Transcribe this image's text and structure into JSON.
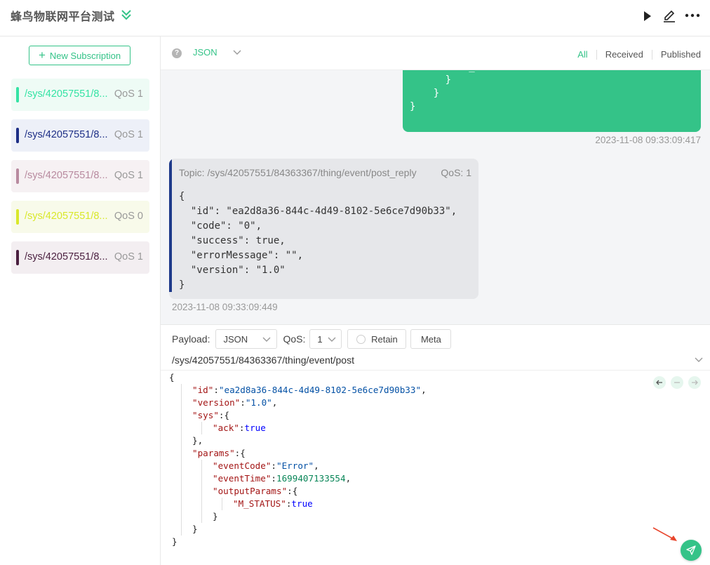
{
  "header": {
    "title": "蜂鸟物联网平台测试",
    "play_icon": "play-icon",
    "edit_icon": "edit-icon",
    "more_icon": "more-icon"
  },
  "sidebar": {
    "new_subscription": "New Subscription",
    "subscriptions": [
      {
        "topic": "/sys/42057551/8...",
        "qos": "QoS 1",
        "color": "#34e3a4",
        "bg": "#eefbf5"
      },
      {
        "topic": "/sys/42057551/8...",
        "qos": "QoS 1",
        "color": "#1e2f86",
        "bg": "#edf0f8"
      },
      {
        "topic": "/sys/42057551/8...",
        "qos": "QoS 1",
        "color": "#b88a9f",
        "bg": "#f6f1f3"
      },
      {
        "topic": "/sys/42057551/8...",
        "qos": "QoS 0",
        "color": "#d9e82a",
        "bg": "#f8faea"
      },
      {
        "topic": "/sys/42057551/8...",
        "qos": "QoS 1",
        "color": "#4a1f3f",
        "bg": "#f3eef1"
      }
    ]
  },
  "messages": {
    "format": "JSON",
    "filters": {
      "all": "All",
      "received": "Received",
      "published": "Published"
    },
    "sent": {
      "body": "        \"M_STATUS\":true\n      }\n    }\n}",
      "time": "2023-11-08 09:33:09:417"
    },
    "received": {
      "topic": "Topic: /sys/42057551/84363367/thing/event/post_reply",
      "qos": "QoS: 1",
      "body": "{\n  \"id\": \"ea2d8a36-844c-4d49-8102-5e6ce7d90b33\",\n  \"code\": \"0\",\n  \"success\": true,\n  \"errorMessage\": \"\",\n  \"version\": \"1.0\"\n}",
      "time": "2023-11-08 09:33:09:449"
    }
  },
  "compose": {
    "payload_label": "Payload:",
    "payload_format": "JSON",
    "qos_label": "QoS:",
    "qos_value": "1",
    "retain": "Retain",
    "meta": "Meta",
    "topic": "/sys/42057551/84363367/thing/event/post",
    "editor": {
      "l1": "{",
      "id_key": "\"id\"",
      "id_val": "\"ea2d8a36-844c-4d49-8102-5e6ce7d90b33\"",
      "version_key": "\"version\"",
      "version_val": "\"1.0\"",
      "sys_key": "\"sys\"",
      "ack_key": "\"ack\"",
      "ack_val": "true",
      "params_key": "\"params\"",
      "eventCode_key": "\"eventCode\"",
      "eventCode_val": "\"Error\"",
      "eventTime_key": "\"eventTime\"",
      "eventTime_val": "1699407133554",
      "outputParams_key": "\"outputParams\"",
      "mstatus_key": "\"M_STATUS\"",
      "mstatus_val": "true"
    }
  },
  "accent": "#34c388"
}
